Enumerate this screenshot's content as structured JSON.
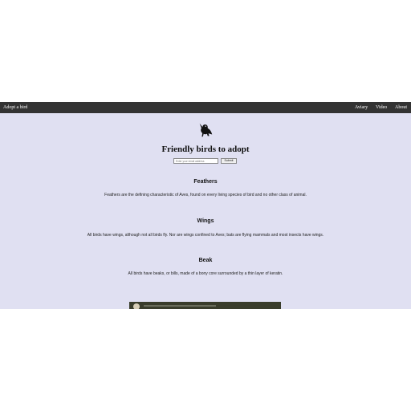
{
  "navbar": {
    "brand": "Adopt a bird",
    "links": [
      {
        "label": "Aviary"
      },
      {
        "label": "Video"
      },
      {
        "label": "About"
      }
    ]
  },
  "hero": {
    "title": "Friendly birds to adopt",
    "logo_icon": "bird-icon"
  },
  "signup": {
    "email_placeholder": "Enter your email address",
    "submit_label": "Submit"
  },
  "sections": [
    {
      "heading": "Feathers",
      "text": "Feathers are the defining characteristic of Aves, found on every living species of bird and no other class of animal."
    },
    {
      "heading": "Wings",
      "text": "All birds have wings, although not all birds fly. Nor are wings confined to Aves; bats are flying mammals and most insects have wings."
    },
    {
      "heading": "Beak",
      "text": "All birds have beaks, or bills, made of a bony core surrounded by a thin layer of keratin."
    }
  ],
  "colors": {
    "navbar_bg": "#333333",
    "page_bg": "#e0e0f2"
  }
}
